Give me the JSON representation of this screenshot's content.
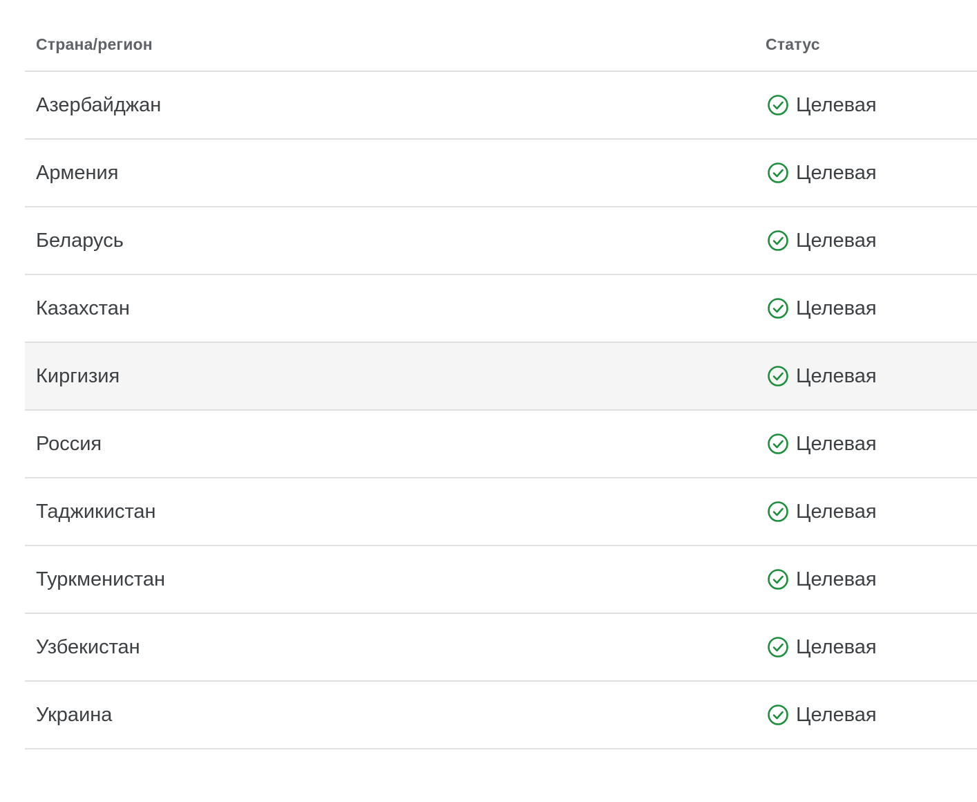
{
  "table": {
    "headers": {
      "country": "Страна/регион",
      "status": "Статус"
    },
    "status_icon": "check-circle-icon",
    "status_color": "#1e8e3e",
    "hovered_row_index": 4,
    "rows": [
      {
        "country": "Азербайджан",
        "status": "Целевая"
      },
      {
        "country": "Армения",
        "status": "Целевая"
      },
      {
        "country": "Беларусь",
        "status": "Целевая"
      },
      {
        "country": "Казахстан",
        "status": "Целевая"
      },
      {
        "country": "Киргизия",
        "status": "Целевая"
      },
      {
        "country": "Россия",
        "status": "Целевая"
      },
      {
        "country": "Таджикистан",
        "status": "Целевая"
      },
      {
        "country": "Туркменистан",
        "status": "Целевая"
      },
      {
        "country": "Узбекистан",
        "status": "Целевая"
      },
      {
        "country": "Украина",
        "status": "Целевая"
      }
    ]
  }
}
